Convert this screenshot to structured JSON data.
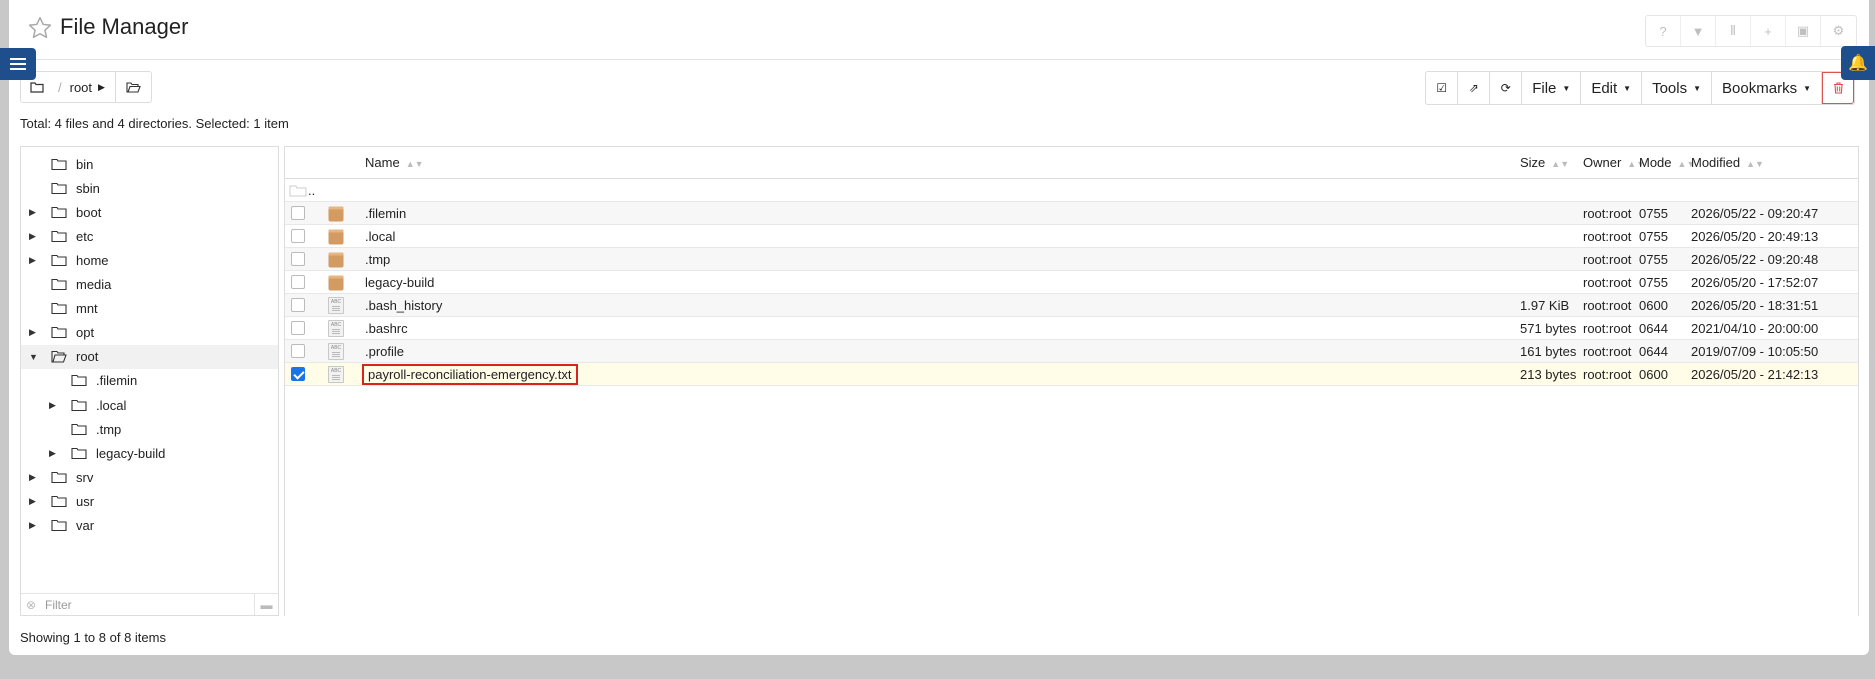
{
  "header": {
    "title": "File Manager",
    "icons": [
      "help-icon",
      "filter-icon",
      "columns-icon",
      "plus-icon",
      "terminal-icon",
      "gear-icon"
    ]
  },
  "breadcrumb": {
    "separator": "/",
    "current": "root"
  },
  "toolbar": {
    "file_label": "File",
    "edit_label": "Edit",
    "tools_label": "Tools",
    "bookmarks_label": "Bookmarks"
  },
  "status_text": "Total: 4 files and 4 directories. Selected: 1 item",
  "tree": {
    "nodes": [
      {
        "label": "bin",
        "expander": "",
        "level": 0
      },
      {
        "label": "sbin",
        "expander": "",
        "level": 0
      },
      {
        "label": "boot",
        "expander": "collapsed",
        "level": 0
      },
      {
        "label": "etc",
        "expander": "collapsed",
        "level": 0
      },
      {
        "label": "home",
        "expander": "collapsed",
        "level": 0
      },
      {
        "label": "media",
        "expander": "",
        "level": 0
      },
      {
        "label": "mnt",
        "expander": "",
        "level": 0
      },
      {
        "label": "opt",
        "expander": "collapsed",
        "level": 0
      },
      {
        "label": "root",
        "expander": "expanded",
        "level": 0,
        "selected": true
      },
      {
        "label": ".filemin",
        "expander": "",
        "level": 1
      },
      {
        "label": ".local",
        "expander": "collapsed",
        "level": 1
      },
      {
        "label": ".tmp",
        "expander": "",
        "level": 1
      },
      {
        "label": "legacy-build",
        "expander": "collapsed",
        "level": 1
      },
      {
        "label": "srv",
        "expander": "collapsed",
        "level": 0
      },
      {
        "label": "usr",
        "expander": "collapsed",
        "level": 0
      },
      {
        "label": "var",
        "expander": "collapsed",
        "level": 0
      }
    ],
    "filter_placeholder": "Filter"
  },
  "table": {
    "columns": {
      "name": "Name",
      "size": "Size",
      "owner": "Owner",
      "mode": "Mode",
      "modified": "Modified"
    },
    "parent_label": "..",
    "rows": [
      {
        "type": "folder",
        "name": ".filemin",
        "size": "",
        "owner": "root:root",
        "mode": "0755",
        "modified": "2026/05/22 - 09:20:47",
        "checked": false
      },
      {
        "type": "folder",
        "name": ".local",
        "size": "",
        "owner": "root:root",
        "mode": "0755",
        "modified": "2026/05/20 - 20:49:13",
        "checked": false
      },
      {
        "type": "folder",
        "name": ".tmp",
        "size": "",
        "owner": "root:root",
        "mode": "0755",
        "modified": "2026/05/22 - 09:20:48",
        "checked": false
      },
      {
        "type": "folder",
        "name": "legacy-build",
        "size": "",
        "owner": "root:root",
        "mode": "0755",
        "modified": "2026/05/20 - 17:52:07",
        "checked": false
      },
      {
        "type": "file",
        "name": ".bash_history",
        "size": "1.97 KiB",
        "owner": "root:root",
        "mode": "0600",
        "modified": "2026/05/20 - 18:31:51",
        "checked": false
      },
      {
        "type": "file",
        "name": ".bashrc",
        "size": "571 bytes",
        "owner": "root:root",
        "mode": "0644",
        "modified": "2021/04/10 - 20:00:00",
        "checked": false
      },
      {
        "type": "file",
        "name": ".profile",
        "size": "161 bytes",
        "owner": "root:root",
        "mode": "0644",
        "modified": "2019/07/09 - 10:05:50",
        "checked": false
      },
      {
        "type": "file",
        "name": "payroll-reconciliation-emergency.txt",
        "size": "213 bytes",
        "owner": "root:root",
        "mode": "0600",
        "modified": "2026/05/20 - 21:42:13",
        "checked": true
      }
    ]
  },
  "footer_text": "Showing 1 to 8 of 8 items",
  "colors": {
    "accent": "#1f4e8c",
    "folder": "#d39a62",
    "danger": "#d9534f",
    "checkbox": "#1a73e8"
  }
}
